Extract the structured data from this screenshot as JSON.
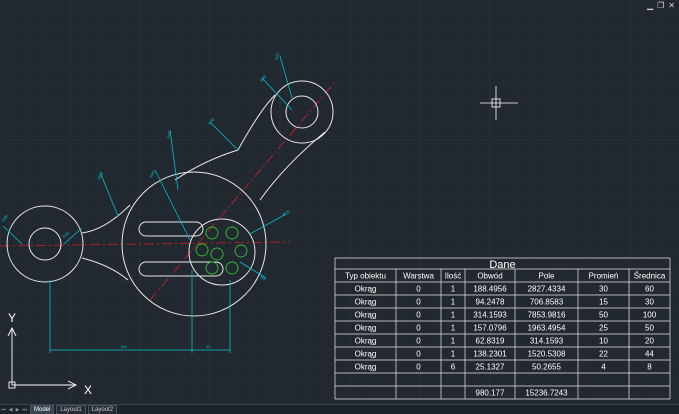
{
  "window": {
    "controls": [
      "minimize-icon",
      "restore-icon",
      "close-icon"
    ]
  },
  "tabs": {
    "model": "Model",
    "layout1": "Layout1",
    "layout2": "Layout2"
  },
  "ucs": {
    "x_label": "X",
    "y_label": "Y"
  },
  "dimensions": {
    "linear_100": "100",
    "linear_20": "20",
    "d1": "R60",
    "d2": "R30",
    "d3": "R50",
    "d4": "R45",
    "d5": "R15",
    "d6": "R30",
    "d7": "R25",
    "d8": "R22",
    "d9": "R20",
    "d10": "R4"
  },
  "table": {
    "title": "Dane",
    "headers": [
      "Typ obiektu",
      "Warstwa",
      "Ilość",
      "Obwód",
      "Pole",
      "Promień",
      "Średnica"
    ],
    "rows": [
      [
        "Okrąg",
        "0",
        "1",
        "188.4956",
        "2827.4334",
        "30",
        "60"
      ],
      [
        "Okrąg",
        "0",
        "1",
        "94.2478",
        "706.8583",
        "15",
        "30"
      ],
      [
        "Okrąg",
        "0",
        "1",
        "314.1593",
        "7853.9816",
        "50",
        "100"
      ],
      [
        "Okrąg",
        "0",
        "1",
        "157.0796",
        "1963.4954",
        "25",
        "50"
      ],
      [
        "Okrąg",
        "0",
        "1",
        "62.8319",
        "314.1593",
        "10",
        "20"
      ],
      [
        "Okrąg",
        "0",
        "1",
        "138.2301",
        "1520.5308",
        "22",
        "44"
      ],
      [
        "Okrąg",
        "0",
        "6",
        "25.1327",
        "50.2655",
        "4",
        "8"
      ]
    ],
    "blank_row": [
      "",
      "",
      "",
      "",
      "",
      "",
      ""
    ],
    "totals": [
      "",
      "",
      "",
      "980.177",
      "15236.7243",
      "",
      ""
    ]
  },
  "colors": {
    "background": "#212830",
    "drawing": "#ffffff",
    "dimension": "#00c8d8",
    "centerline": "#e02020",
    "small_circles": "#30c030"
  }
}
